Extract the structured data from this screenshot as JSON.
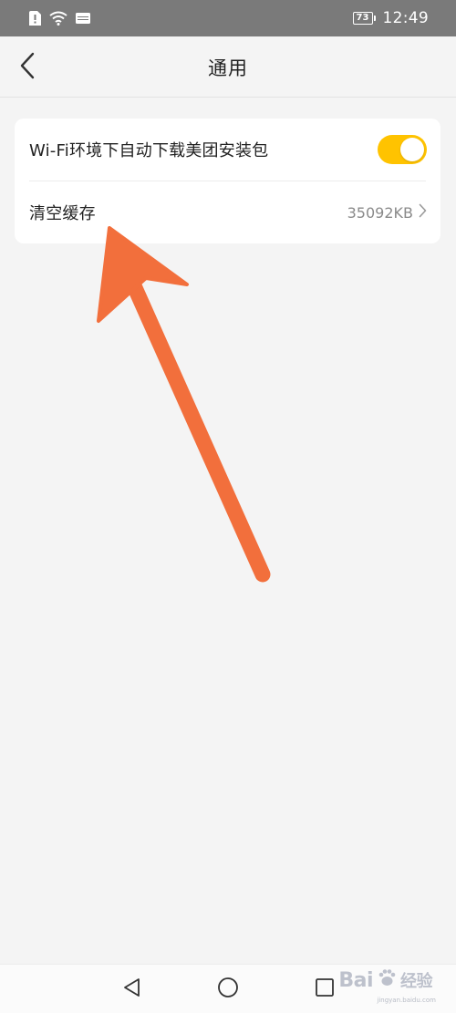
{
  "status_bar": {
    "battery_level": "73",
    "time": "12:49",
    "icons": [
      "alert-icon",
      "wifi-icon",
      "hd-icon",
      "battery-icon"
    ]
  },
  "header": {
    "title": "通用",
    "back_icon": "chevron-left-icon"
  },
  "settings": {
    "wifi_auto_download": {
      "label": "Wi-Fi环境下自动下载美团安装包",
      "enabled": true
    },
    "clear_cache": {
      "label": "清空缓存",
      "size": "35092KB",
      "chevron_icon": "chevron-right-icon"
    }
  },
  "nav_bar": {
    "icons": [
      "nav-back-icon",
      "nav-home-icon",
      "nav-recent-icon"
    ]
  },
  "watermark": {
    "text": "Bai",
    "text2": "经验",
    "sub": "jingyan.baidu.com"
  },
  "colors": {
    "accent": "#ffc300",
    "arrow": "#f26f3c",
    "status_bar": "#7a7a7a",
    "background": "#f4f4f4"
  }
}
